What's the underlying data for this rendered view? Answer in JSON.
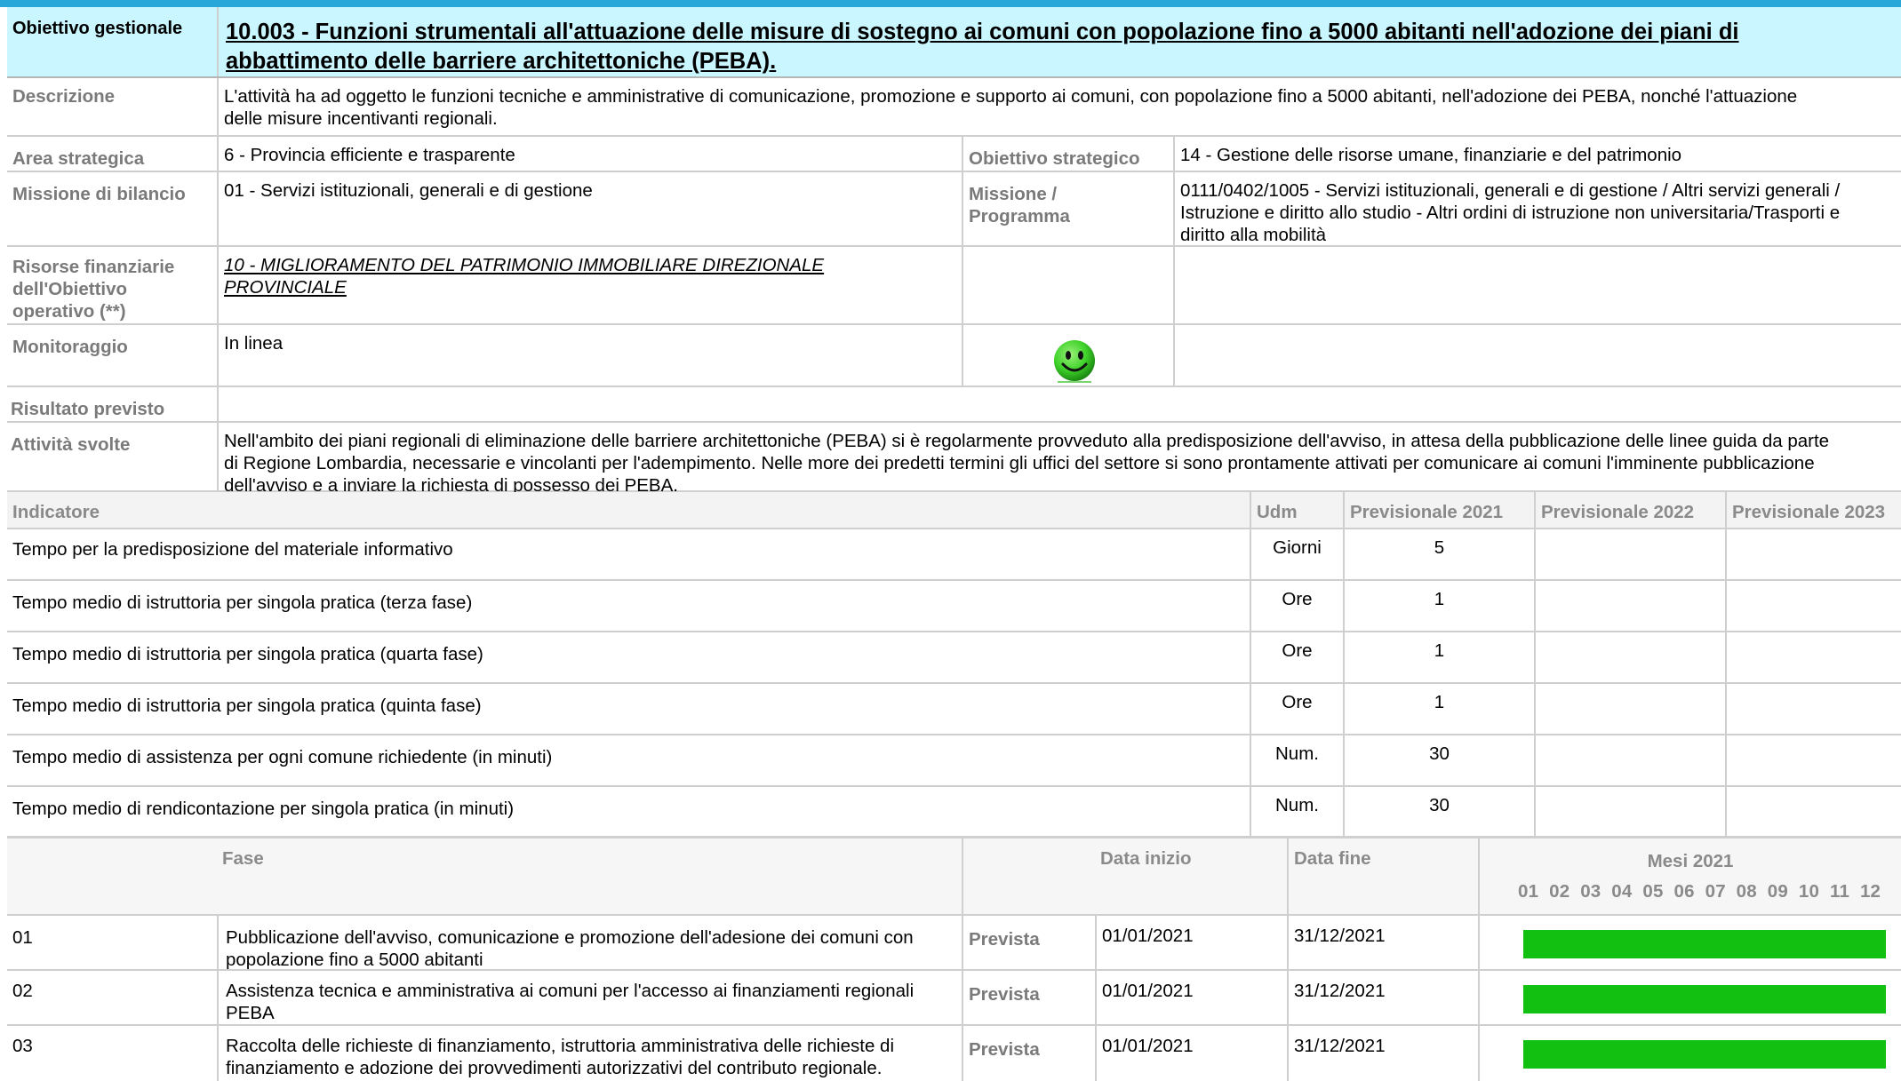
{
  "objective": {
    "label": "Obiettivo gestionale",
    "title_line1": "10.003 - Funzioni strumentali all'attuazione delle misure di sostegno ai comuni con popolazione fino a 5000 abitanti nell'adozione dei piani di",
    "title_line2": "abbattimento delle barriere architettoniche (PEBA)."
  },
  "description": {
    "label": "Descrizione",
    "line1": "L'attività ha ad oggetto le funzioni tecniche e amministrative  di comunicazione, promozione e supporto ai comuni, con popolazione fino a 5000 abitanti, nell'adozione dei PEBA, nonché l'attuazione",
    "line2": "delle misure incentivanti regionali."
  },
  "area": {
    "label": "Area strategica",
    "value": "6 - Provincia efficiente e trasparente",
    "label2": "Obiettivo strategico",
    "value2": "14 - Gestione delle risorse umane, finanziarie e del patrimonio"
  },
  "mission": {
    "label": "Missione di bilancio",
    "value": "01 - Servizi istituzionali, generali e di gestione",
    "label2_line1": "Missione /",
    "label2_line2": "Programma",
    "value2_line1": "0111/0402/1005 - Servizi istituzionali, generali e di gestione / Altri servizi generali /",
    "value2_line2": "Istruzione e diritto allo studio - Altri ordini di istruzione non universitaria/Trasporti e",
    "value2_line3": "diritto alla mobilità"
  },
  "resources": {
    "label_line1": "Risorse finanziarie",
    "label_line2": "dell'Obiettivo",
    "label_line3": "operativo (**)",
    "link_line1": "10 - MIGLIORAMENTO DEL PATRIMONIO IMMOBILIARE DIREZIONALE ",
    "link_line2": "PROVINCIALE"
  },
  "monitoring": {
    "label": "Monitoraggio",
    "value": "In linea",
    "icon": "smiley-face-icon",
    "icon_color": "#3fd22a"
  },
  "expected_result": {
    "label": "Risultato previsto",
    "value": ""
  },
  "activities": {
    "label": "Attività svolte",
    "line1": "Nell'ambito dei piani regionali di eliminazione delle barriere architettoniche (PEBA) si è regolarmente provveduto alla predisposizione dell'avviso, in attesa della pubblicazione delle linee guida da parte",
    "line2": "di Regione Lombardia, necessarie e vincolanti per l'adempimento. Nelle more dei predetti termini gli uffici del settore si sono prontamente attivati per comunicare ai comuni l'imminente pubblicazione",
    "line3": "dell'avviso e a inviare la richiesta di possesso dei PEBA."
  },
  "indicators": {
    "headers": [
      "Indicatore",
      "Udm",
      "Previsionale 2021",
      "Previsionale 2022",
      "Previsionale 2023"
    ],
    "rows": [
      {
        "name": "Tempo per la predisposizione del materiale informativo",
        "udm": "Giorni",
        "p2021": "5",
        "p2022": "",
        "p2023": ""
      },
      {
        "name": "Tempo medio di istruttoria per singola pratica (terza fase)",
        "udm": "Ore",
        "p2021": "1",
        "p2022": "",
        "p2023": ""
      },
      {
        "name": "Tempo medio di istruttoria per singola pratica (quarta fase)",
        "udm": "Ore",
        "p2021": "1",
        "p2022": "",
        "p2023": ""
      },
      {
        "name": "Tempo medio di istruttoria per singola pratica (quinta fase)",
        "udm": "Ore",
        "p2021": "1",
        "p2022": "",
        "p2023": ""
      },
      {
        "name": "Tempo medio di assistenza per ogni comune richiedente (in minuti)",
        "udm": "Num.",
        "p2021": "30",
        "p2022": "",
        "p2023": ""
      },
      {
        "name": "Tempo medio di rendicontazione per singola pratica (in minuti)",
        "udm": "Num.",
        "p2021": "30",
        "p2022": "",
        "p2023": ""
      }
    ]
  },
  "phases": {
    "headers": {
      "fase": "Fase",
      "start": "Data inizio",
      "end": "Data fine",
      "months_title": "Mesi 2021",
      "months": "01 02 03 04 05 06 07 08 09 10 11 12"
    },
    "bar_color": "#11c011",
    "rows": [
      {
        "num": "01",
        "desc_line1": "Pubblicazione dell'avviso, comunicazione e promozione dell'adesione dei comuni con",
        "desc_line2": "popolazione fino a 5000 abitanti",
        "type": "Prevista",
        "start": "01/01/2021",
        "end": "31/12/2021",
        "bar_months": [
          1,
          12
        ]
      },
      {
        "num": "02",
        "desc_line1": "Assistenza tecnica e amministrativa ai comuni per l'accesso ai finanziamenti regionali",
        "desc_line2": "PEBA",
        "type": "Prevista",
        "start": "01/01/2021",
        "end": "31/12/2021",
        "bar_months": [
          1,
          12
        ]
      },
      {
        "num": "03",
        "desc_line1": "Raccolta delle richieste di finanziamento, istruttoria amministrativa delle richieste di",
        "desc_line2": "finanziamento e adozione dei provvedimenti autorizzativi del contributo regionale.",
        "type": "Prevista",
        "start": "01/01/2021",
        "end": "31/12/2021",
        "bar_months": [
          1,
          12
        ]
      }
    ]
  }
}
